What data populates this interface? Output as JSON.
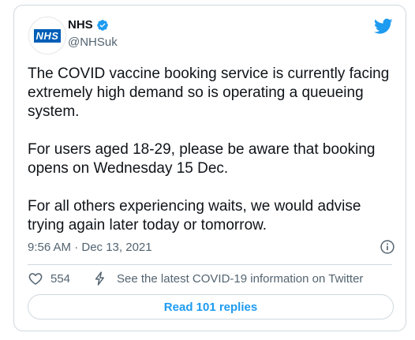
{
  "account": {
    "logo_text": "NHS",
    "display_name": "NHS",
    "handle": "@NHSuk"
  },
  "tweet": {
    "paragraphs": [
      "The COVID vaccine booking service is currently facing extremely high demand so is operating a queueing system.",
      "For users aged 18-29, please be aware that booking opens on Wednesday 15 Dec.",
      "For all others experiencing waits, we would advise trying again later today or tomorrow."
    ],
    "timestamp": "9:56 AM · Dec 13, 2021"
  },
  "actions": {
    "like_count": "554",
    "covid_info_label": "See the latest COVID-19 information on Twitter",
    "read_replies_label": "Read 101 replies"
  },
  "colors": {
    "brand_blue": "#1d9bf0",
    "nhs_blue": "#005eb8",
    "muted_text": "#536471",
    "border": "#cfd9de"
  },
  "icons": [
    "nhs-logo",
    "verified-badge-icon",
    "twitter-bird-icon",
    "info-icon",
    "heart-icon",
    "lightning-bolt-icon"
  ]
}
